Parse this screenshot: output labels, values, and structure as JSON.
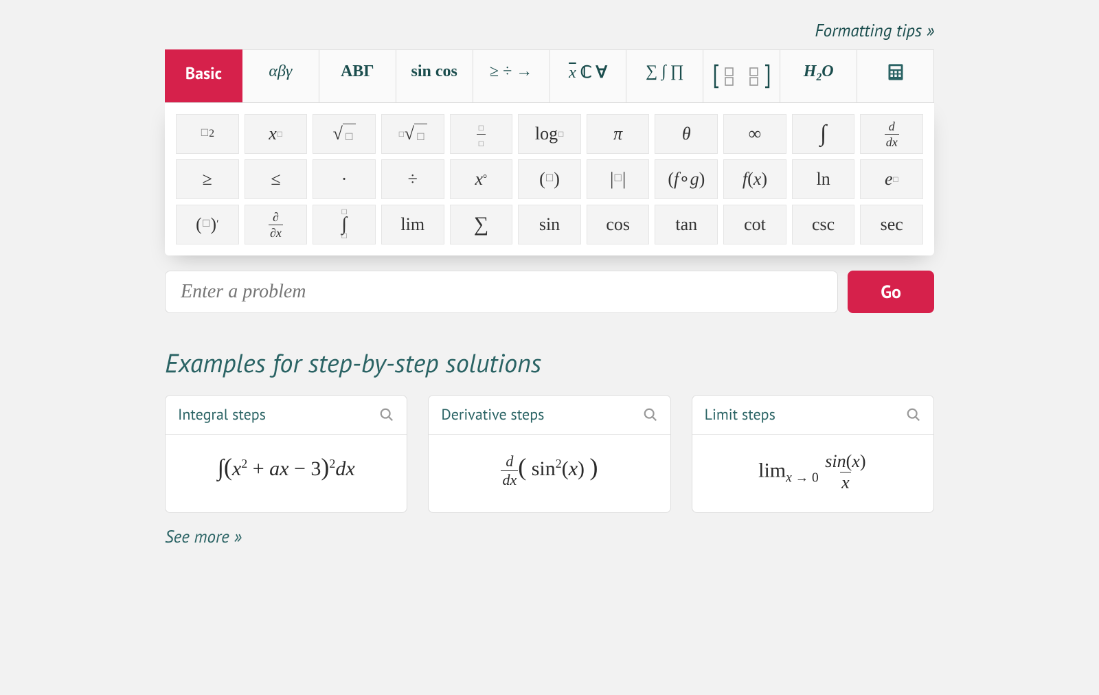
{
  "tips_label": "Formatting tips »",
  "tabs": {
    "basic": "Basic",
    "greek_lower": "αβγ",
    "greek_upper": "ΑΒΓ",
    "trig": "sin cos",
    "relations": "≥ ÷ →",
    "sets": "x̄ ℂ ∀",
    "bigops": "∑ ∫ ∏",
    "matrix": "matrix",
    "chem": "H₂O",
    "calc": "calculator"
  },
  "keypad": {
    "row1": [
      "square",
      "power",
      "sqrt",
      "nthroot",
      "frac",
      "log",
      "pi",
      "theta",
      "infty",
      "int",
      "ddx"
    ],
    "row2": [
      "geq",
      "leq",
      "cdot",
      "div",
      "xdeg",
      "paren",
      "abs",
      "fog",
      "fx",
      "ln",
      "exp"
    ],
    "row3": [
      "primed",
      "partial",
      "defint",
      "lim",
      "sum",
      "sin",
      "cos",
      "tan",
      "cot",
      "csc",
      "sec"
    ],
    "labels": {
      "pi": "π",
      "theta": "θ",
      "infty": "∞",
      "geq": "≥",
      "leq": "≤",
      "cdot": "·",
      "div": "÷",
      "fog": "( f ∘ g )",
      "fx": "f (x)",
      "ln": "ln",
      "lim": "lim",
      "sum": "∑",
      "sin": "sin",
      "cos": "cos",
      "tan": "tan",
      "cot": "cot",
      "csc": "csc",
      "sec": "sec"
    }
  },
  "input": {
    "placeholder": "Enter a problem"
  },
  "go_label": "Go",
  "examples_heading": "Examples for step-by-step solutions",
  "examples": [
    {
      "title": "Integral steps",
      "id": "integral"
    },
    {
      "title": "Derivative steps",
      "id": "derivative"
    },
    {
      "title": "Limit steps",
      "id": "limit"
    }
  ],
  "see_more": "See more »"
}
